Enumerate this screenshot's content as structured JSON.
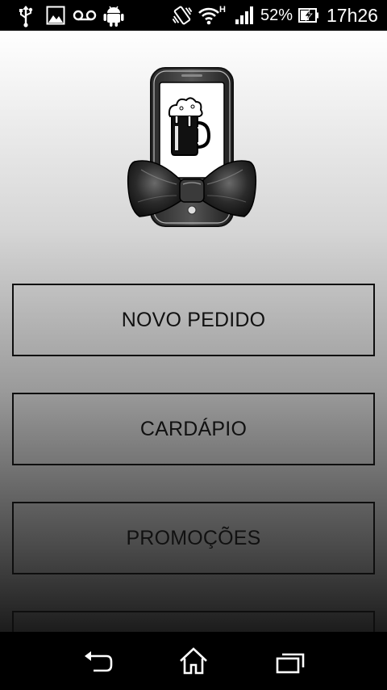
{
  "status_bar": {
    "signal_type": "H",
    "battery_percent": "52%",
    "time": "17h26",
    "icons": [
      "usb-icon",
      "image-icon",
      "voicemail-icon",
      "android-icon",
      "vibrate-icon",
      "wifi-icon",
      "signal-icon",
      "battery-charging-icon"
    ]
  },
  "logo": {
    "icon": "phone-beer-bowtie-logo"
  },
  "menu": {
    "items": [
      {
        "label": "NOVO PEDIDO"
      },
      {
        "label": "CARDÁPIO"
      },
      {
        "label": "PROMOÇÕES"
      },
      {
        "label": ""
      }
    ]
  },
  "nav_bar": {
    "icons": [
      "back-icon",
      "home-icon",
      "recent-apps-icon"
    ]
  }
}
